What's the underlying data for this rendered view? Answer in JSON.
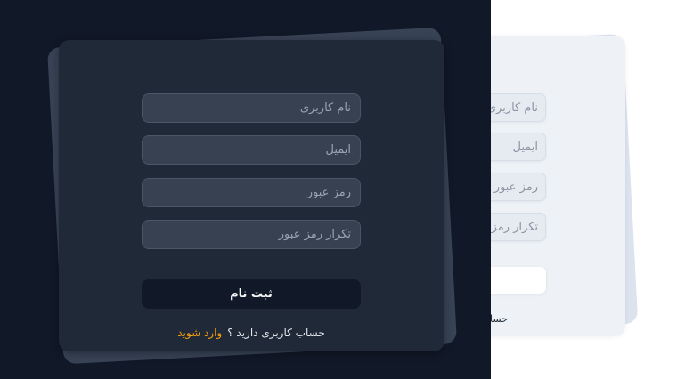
{
  "register_dark": {
    "fields": [
      {
        "placeholder": "نام کاربری"
      },
      {
        "placeholder": "ایمیل"
      },
      {
        "placeholder": "رمز عبور"
      },
      {
        "placeholder": "تکرار رمز عبور"
      }
    ],
    "submit_label": "ثبت نام",
    "footer_text": "حساب کاربری دارید ؟",
    "login_link": "وارد شوید"
  },
  "register_light": {
    "fields": [
      {
        "placeholder": "نام کاربری"
      },
      {
        "placeholder": "ایمیل"
      },
      {
        "placeholder": "رمز عبور"
      },
      {
        "placeholder": "تکرار رمز عبور"
      }
    ],
    "footer_text": "حسا"
  },
  "colors": {
    "dark_background": "#111827",
    "dark_card": "#1f2937",
    "dark_input": "#374151",
    "light_card": "#eef2f7",
    "link_accent": "#f59e0b"
  }
}
